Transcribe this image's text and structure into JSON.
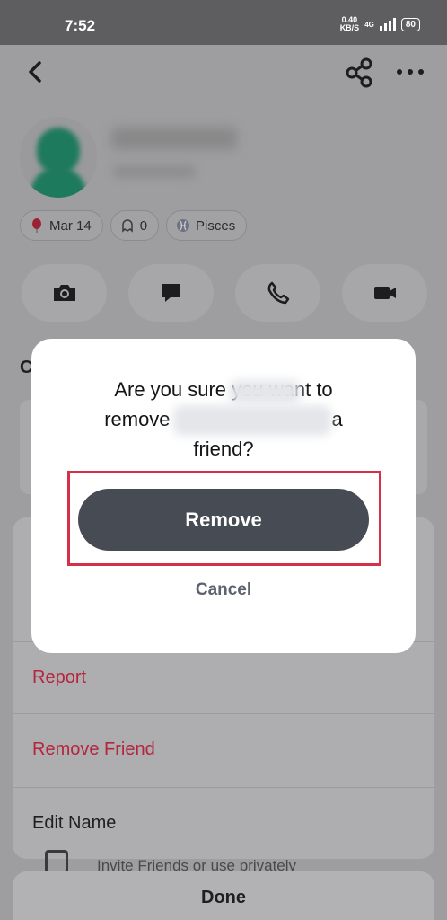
{
  "status_bar": {
    "time": "7:52",
    "net_speed_value": "0.40",
    "net_speed_unit": "KB/S",
    "network_type": "4G",
    "battery": "80"
  },
  "profile": {
    "chips": [
      {
        "icon": "balloon-icon",
        "label": "Mar 14"
      },
      {
        "icon": "ghost-icon",
        "label": "0"
      },
      {
        "icon": "pisces-icon",
        "label": "Pisces"
      }
    ],
    "section_initial": "C"
  },
  "sheet": {
    "items": [
      {
        "label": "Report"
      },
      {
        "label": "Remove Friend"
      },
      {
        "label": "Edit Name"
      }
    ],
    "invite_text": "Invite Friends or use privately",
    "done_label": "Done"
  },
  "dialog": {
    "line1": "Are you sure you want to",
    "line2_start": "remove",
    "line2_end": "a",
    "line3": "friend?",
    "remove_label": "Remove",
    "cancel_label": "Cancel"
  },
  "colors": {
    "destructive": "#b6243d",
    "primary_button": "#474b53",
    "highlight": "#d52f4a"
  }
}
